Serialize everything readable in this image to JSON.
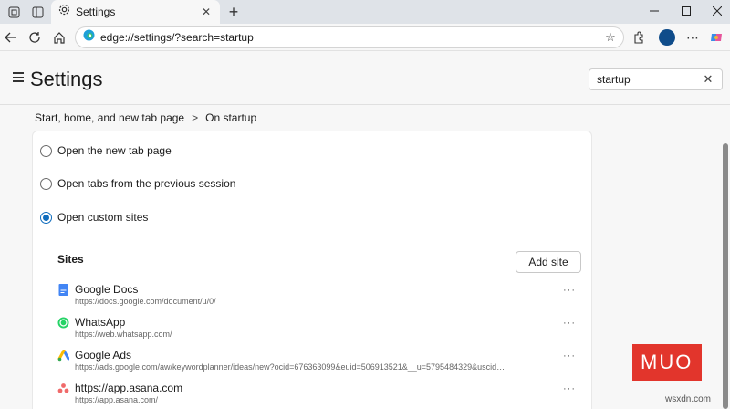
{
  "tab": {
    "title": "Settings",
    "close": "✕"
  },
  "toolbar": {
    "url": "edge://settings/?search=startup",
    "newtab": "+"
  },
  "page": {
    "title": "Settings",
    "search_value": "startup",
    "breadcrumb": {
      "parent": "Start, home, and new tab page",
      "sep": ">",
      "current": "On startup"
    }
  },
  "options": [
    {
      "label": "Open the new tab page",
      "checked": false
    },
    {
      "label": "Open tabs from the previous session",
      "checked": false
    },
    {
      "label": "Open custom sites",
      "checked": true
    }
  ],
  "sites": {
    "heading": "Sites",
    "add_label": "Add site",
    "items": [
      {
        "name": "Google Docs",
        "url": "https://docs.google.com/document/u/0/",
        "icon": "google-docs-icon"
      },
      {
        "name": "WhatsApp",
        "url": "https://web.whatsapp.com/",
        "icon": "whatsapp-icon"
      },
      {
        "name": "Google Ads",
        "url": "https://ads.google.com/aw/keywordplanner/ideas/new?ocid=676363099&euid=506913521&__u=5795484329&uscid…",
        "icon": "google-ads-icon"
      },
      {
        "name": "https://app.asana.com",
        "url": "https://app.asana.com/",
        "icon": "asana-icon"
      }
    ]
  },
  "watermark": {
    "logo": "MUO",
    "site": "wsxdn.com"
  }
}
